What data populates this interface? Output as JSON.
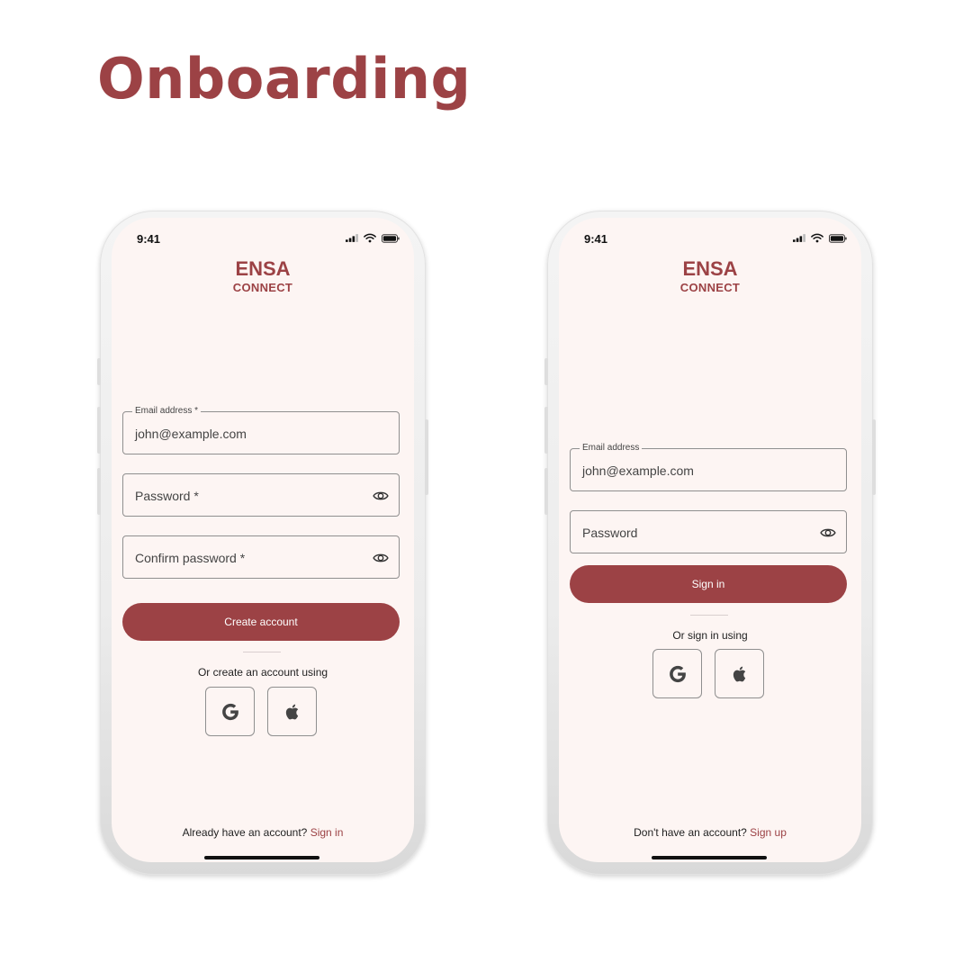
{
  "page": {
    "title": "Onboarding"
  },
  "colors": {
    "brand": "#9c4245",
    "screen_bg": "#fdf5f3",
    "border": "#8f8f8f"
  },
  "icons": {
    "eye": "eye-icon",
    "google": "google-icon",
    "apple": "apple-icon",
    "signal": "signal-icon",
    "wifi": "wifi-icon",
    "battery": "battery-icon"
  },
  "signup_screen": {
    "status_time": "9:41",
    "logo": {
      "main": "ENSA",
      "sub": "CONNECT"
    },
    "email_field": {
      "label": "Email address *",
      "value": "john@example.com"
    },
    "password_field": {
      "placeholder": "Password *"
    },
    "confirm_field": {
      "placeholder": "Confirm password *"
    },
    "primary_button": "Create account",
    "alt_text": "Or create an account using",
    "footer": {
      "text": "Already have an account?",
      "link": "Sign in"
    }
  },
  "signin_screen": {
    "status_time": "9:41",
    "logo": {
      "main": "ENSA",
      "sub": "CONNECT"
    },
    "email_field": {
      "label": "Email address",
      "value": "john@example.com"
    },
    "password_field": {
      "placeholder": "Password"
    },
    "primary_button": "Sign in",
    "alt_text": "Or sign in using",
    "footer": {
      "text": "Don't have an account?",
      "link": "Sign up"
    }
  }
}
